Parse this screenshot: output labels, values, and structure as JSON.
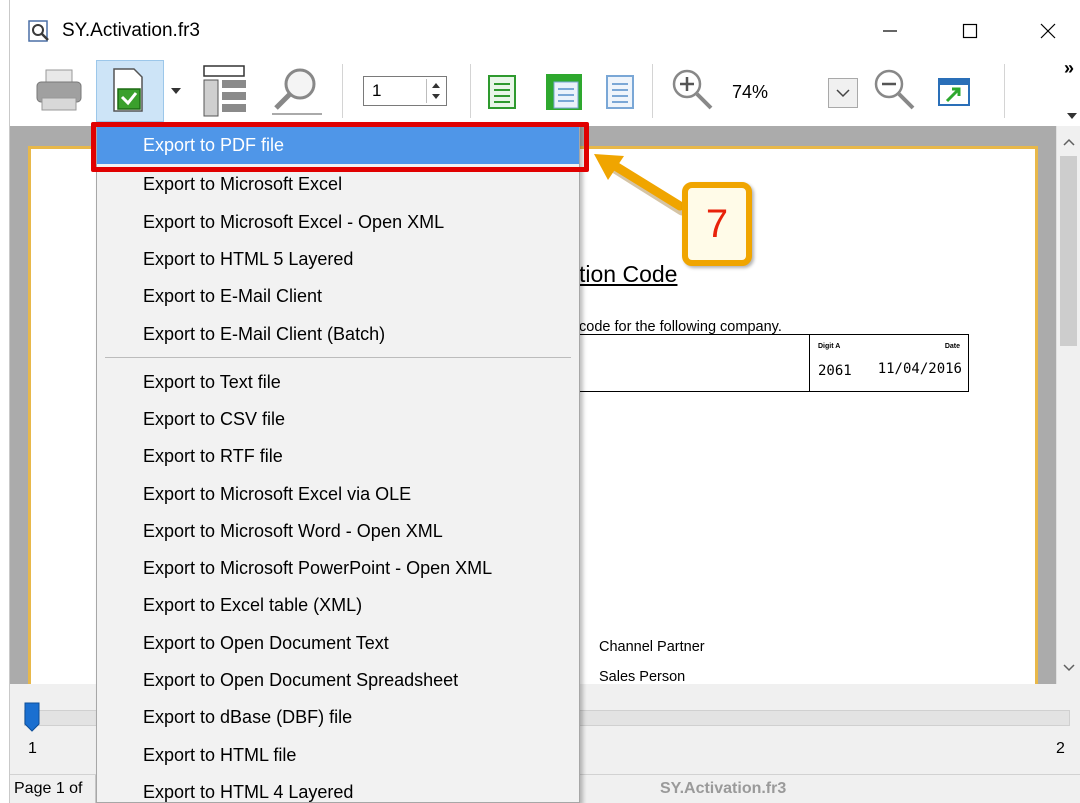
{
  "window": {
    "title": "SY.Activation.fr3"
  },
  "toolbar": {
    "page_value": "1",
    "zoom_level": "74%",
    "overflow_glyph": "»"
  },
  "document": {
    "heading_fragment": "tion Code",
    "line_fragment": "code for the following company.",
    "table": {
      "header_digit": "Digit A",
      "header_date": "Date",
      "value_digit": "2061",
      "value_date": "11/04/2016"
    },
    "label_channel_partner": "Channel Partner",
    "label_sales_person": "Sales Person"
  },
  "export_menu": {
    "items": [
      {
        "label": "Export to PDF file"
      },
      {
        "label": "Export to Microsoft Excel"
      },
      {
        "label": "Export to Microsoft Excel - Open XML"
      },
      {
        "label": "Export to HTML 5 Layered"
      },
      {
        "label": "Export to E-Mail Client"
      },
      {
        "label": "Export to E-Mail Client (Batch)"
      },
      {
        "label": "Export to Text file"
      },
      {
        "label": "Export to CSV file"
      },
      {
        "label": "Export to RTF file"
      },
      {
        "label": "Export to Microsoft Excel via OLE"
      },
      {
        "label": "Export to Microsoft Word - Open XML"
      },
      {
        "label": "Export to Microsoft PowerPoint - Open XML"
      },
      {
        "label": "Export to Excel table (XML)"
      },
      {
        "label": "Export to Open Document Text"
      },
      {
        "label": "Export to Open Document Spreadsheet"
      },
      {
        "label": "Export to dBase (DBF) file"
      },
      {
        "label": "Export to HTML file"
      },
      {
        "label": "Export to HTML 4 Layered"
      }
    ]
  },
  "slider": {
    "min_label": "1",
    "max_label": "2"
  },
  "statusbar": {
    "page_text": "Page 1 of",
    "file_text": "SY.Activation.fr3"
  },
  "callout": {
    "step_number": "7"
  },
  "colors": {
    "menu_highlight": "#4f96e8",
    "annotation_red": "#e00000",
    "callout_orange": "#f0a500",
    "page_border": "#e8b84a"
  }
}
